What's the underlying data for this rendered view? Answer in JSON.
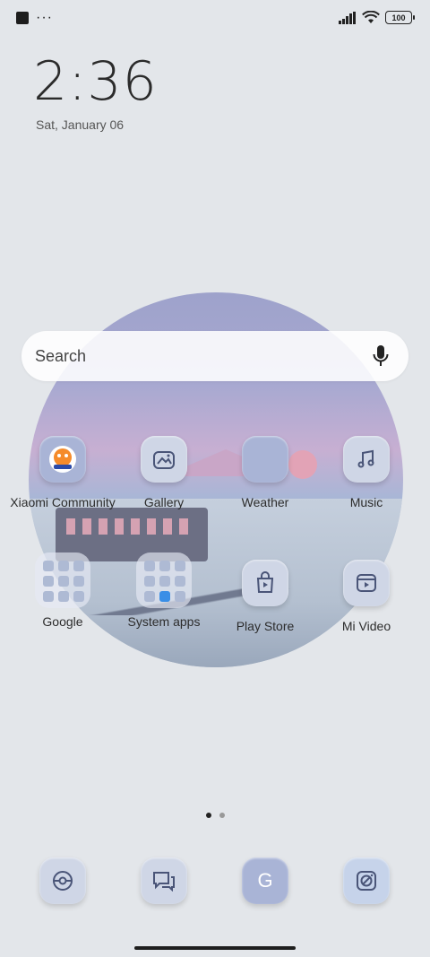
{
  "status_bar": {
    "battery": "100"
  },
  "clock": {
    "time": "2:36",
    "date": "Sat, January 06"
  },
  "search": {
    "placeholder": "Search"
  },
  "apps": [
    {
      "label": "Xiaomi Community",
      "icon": "xiaomi-community-icon"
    },
    {
      "label": "Gallery",
      "icon": "gallery-icon"
    },
    {
      "label": "Weather",
      "icon": "weather-icon"
    },
    {
      "label": "Music",
      "icon": "music-note-icon"
    },
    {
      "label": "Google",
      "icon": "folder-icon"
    },
    {
      "label": "System apps",
      "icon": "folder-icon"
    },
    {
      "label": "Play Store",
      "icon": "play-store-icon"
    },
    {
      "label": "Mi Video",
      "icon": "mi-video-icon"
    }
  ],
  "dock": [
    {
      "icon": "camera-lens-icon"
    },
    {
      "icon": "messages-icon"
    },
    {
      "icon": "google-g-icon",
      "label": "G"
    },
    {
      "icon": "compass-icon"
    }
  ],
  "colors": {
    "background": "#e3e6ea",
    "tile": "#cfd6e6",
    "tile_blue": "#a9b4d6"
  }
}
